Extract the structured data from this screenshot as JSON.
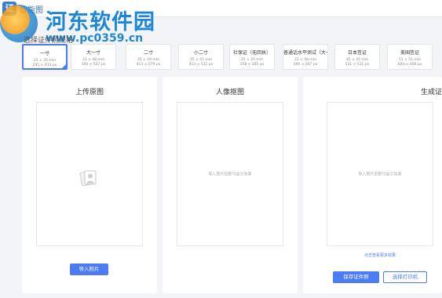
{
  "app": {
    "title": "智能图",
    "logo": "证"
  },
  "watermark": {
    "site_name": "河东软件园",
    "url": "www.pc0359.cn"
  },
  "spec_section": {
    "label": "选择证件照规格"
  },
  "specs": [
    {
      "name": "一寸",
      "mm": "25 × 35 mm",
      "px": "295 × 413 px",
      "selected": true
    },
    {
      "name": "大一寸",
      "mm": "33 × 48 mm",
      "px": "390 × 567 px"
    },
    {
      "name": "二寸",
      "mm": "35 × 49 mm",
      "px": "413 × 579 px"
    },
    {
      "name": "小二寸",
      "mm": "35 × 45 mm",
      "px": "413 × 531 px"
    },
    {
      "name": "社保证（无回执）",
      "mm": "25 × 25 mm",
      "px": "358 × 285 px"
    },
    {
      "name": "普通话水平测试（大一",
      "mm": "33 × 48 mm",
      "px": "390 × 567 px"
    },
    {
      "name": "日本签证",
      "mm": "45 × 45 mm",
      "px": "531 × 531 px"
    },
    {
      "name": "美国签证",
      "mm": "51 × 51 mm",
      "px": "600 × 600 px"
    }
  ],
  "panels": {
    "upload": {
      "title": "上传原图",
      "button": "导入照片"
    },
    "portrait": {
      "title": "人像抠图",
      "hint": "导入照片后即可显示效果"
    },
    "generate": {
      "title": "生成证",
      "hint": "导入照片后即可显示效果",
      "link": "点击查看更多效果",
      "save_button": "保存证件照",
      "print_button": "选择打印机"
    }
  },
  "colors": {
    "primary": "#4b7cf3",
    "background": "#f3f4f7",
    "panel": "#ffffff",
    "watermark": "#1e86d6"
  },
  "icons": {
    "photo": "portrait-photo-icon"
  }
}
